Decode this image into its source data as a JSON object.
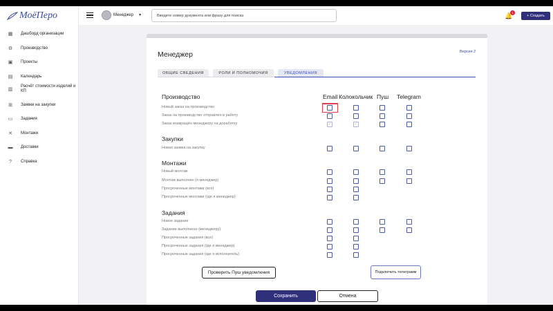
{
  "app": {
    "logo_text": "МоёПеро",
    "brand_color": "#2f2f7a"
  },
  "sidebar": {
    "items": [
      {
        "label": "Дашборд организации",
        "icon": "dashboard-icon"
      },
      {
        "label": "Производство",
        "icon": "production-icon"
      },
      {
        "label": "Проекты",
        "icon": "briefcase-icon"
      },
      {
        "label": "Календарь",
        "icon": "calendar-icon"
      },
      {
        "label": "Расчёт стоимости изделий и КП",
        "icon": "calculator-icon"
      },
      {
        "label": "Заявки на закупки",
        "icon": "cart-icon"
      },
      {
        "label": "Задания",
        "icon": "document-icon"
      },
      {
        "label": "Монтажи",
        "icon": "tools-icon"
      },
      {
        "label": "Доставки",
        "icon": "truck-icon"
      },
      {
        "label": "Справка",
        "icon": "help-icon"
      }
    ]
  },
  "topbar": {
    "user_name": "Менеджер",
    "search_placeholder": "Введите номер документа или фразу для поиска",
    "notification_count": "1",
    "create_label": "+ Создать"
  },
  "card": {
    "title": "Менеджер",
    "version": "Версия 2",
    "tabs": [
      {
        "label": "ОБЩИЕ СВЕДЕНИЯ",
        "active": false
      },
      {
        "label": "РОЛИ И ПОЛНОМОЧИЯ",
        "active": false
      },
      {
        "label": "УВЕДОМЛЕНИЯ",
        "active": true
      }
    ]
  },
  "notifications": {
    "columns": [
      "Email",
      "Колокольчик",
      "Пуш",
      "Telegram"
    ],
    "sections": [
      {
        "title": "Производство",
        "rows": [
          {
            "label": "Новый заказ на производство",
            "channels": [
              true,
              true,
              true,
              true
            ],
            "disabled": [
              false,
              false,
              false,
              false
            ]
          },
          {
            "label": "Заказ на производство отправлен в работу",
            "channels": [
              true,
              true,
              true,
              true
            ],
            "disabled": [
              false,
              false,
              false,
              false
            ]
          },
          {
            "label": "Заказ возвращён менеджеру на доработку",
            "channels": [
              true,
              true,
              true,
              true
            ],
            "disabled": [
              true,
              true,
              false,
              false
            ]
          }
        ]
      },
      {
        "title": "Закупки",
        "rows": [
          {
            "label": "Новая заявка на закупку",
            "channels": [
              true,
              true,
              true,
              true
            ],
            "disabled": [
              false,
              false,
              false,
              false
            ]
          }
        ]
      },
      {
        "title": "Монтажи",
        "rows": [
          {
            "label": "Новый монтаж",
            "channels": [
              true,
              true,
              true,
              true
            ],
            "disabled": [
              false,
              false,
              false,
              false
            ]
          },
          {
            "label": "Монтаж выполнен (я менеджер)",
            "channels": [
              true,
              true,
              true,
              true
            ],
            "disabled": [
              false,
              false,
              false,
              false
            ]
          },
          {
            "label": "Просроченные монтажи (все)",
            "channels": [
              true,
              true,
              false,
              false
            ],
            "disabled": [
              false,
              false,
              false,
              false
            ]
          },
          {
            "label": "Просроченные монтажи (где я менеджер)",
            "channels": [
              true,
              true,
              false,
              false
            ],
            "disabled": [
              false,
              false,
              false,
              false
            ]
          }
        ]
      },
      {
        "title": "Задания",
        "rows": [
          {
            "label": "Новое задание",
            "channels": [
              true,
              true,
              true,
              true
            ],
            "disabled": [
              false,
              false,
              false,
              false
            ]
          },
          {
            "label": "Задание выполнено (менеджеру)",
            "channels": [
              true,
              true,
              true,
              true
            ],
            "disabled": [
              false,
              false,
              false,
              false
            ]
          },
          {
            "label": "Просроченные задания (все)",
            "channels": [
              true,
              true,
              false,
              false
            ],
            "disabled": [
              false,
              false,
              false,
              false
            ]
          },
          {
            "label": "Просроченные задания (где я менеджер)",
            "channels": [
              true,
              true,
              false,
              false
            ],
            "disabled": [
              false,
              false,
              false,
              false
            ]
          },
          {
            "label": "Просроченные задания (где я исполнитель)",
            "channels": [
              true,
              true,
              false,
              false
            ],
            "disabled": [
              false,
              false,
              false,
              false
            ]
          }
        ]
      }
    ]
  },
  "buttons": {
    "check_push": "Проверить Пуш уведомления",
    "connect_telegram": "Подключить телеграмм",
    "save": "Сохранить",
    "cancel": "Отмена"
  }
}
